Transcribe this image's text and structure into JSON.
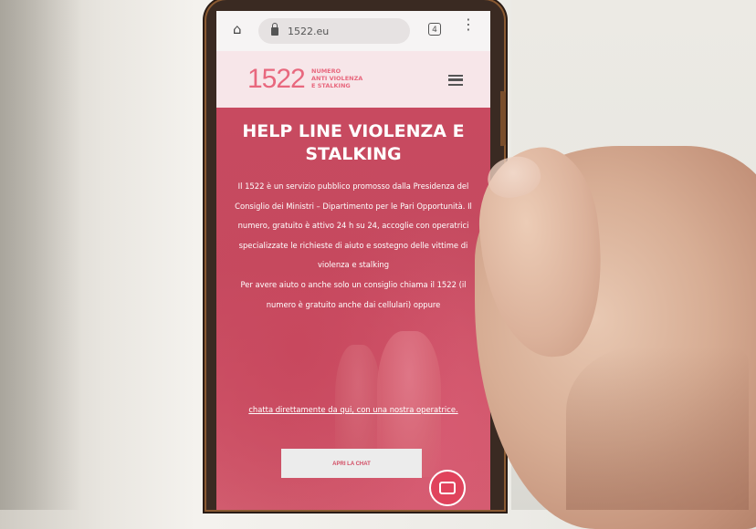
{
  "browser": {
    "url": "1522.eu",
    "tab_count": "4"
  },
  "site": {
    "logo_number": "1522",
    "logo_lines": [
      "NUMERO",
      "ANTI VIOLENZA",
      "E STALKING"
    ]
  },
  "hero": {
    "title_line1": "HELP LINE VIOLENZA E",
    "title_line2": "STALKING",
    "paragraph1": "Il 1522 è un servizio pubblico promosso dalla Presidenza del Consiglio dei Ministri – Dipartimento per le Pari Opportunità. Il numero, gratuito è attivo 24 h su 24, accoglie con operatrici specializzate le richieste di aiuto e sostegno delle vittime di violenza e stalking",
    "paragraph2": "Per avere aiuto o anche solo un consiglio chiama il 1522 (il numero è gratuito anche dai cellulari) oppure",
    "chat_link": "chatta direttamente da qui, con una nostra operatrice.",
    "chat_button": "APRI LA CHAT"
  },
  "colors": {
    "brand": "#e8687e",
    "hero_bg": "#c84a60",
    "fab": "#e0435c"
  },
  "icons": [
    "home-icon",
    "lock-icon",
    "tabs-icon",
    "kebab-menu-icon",
    "hamburger-menu-icon",
    "chat-icon"
  ]
}
